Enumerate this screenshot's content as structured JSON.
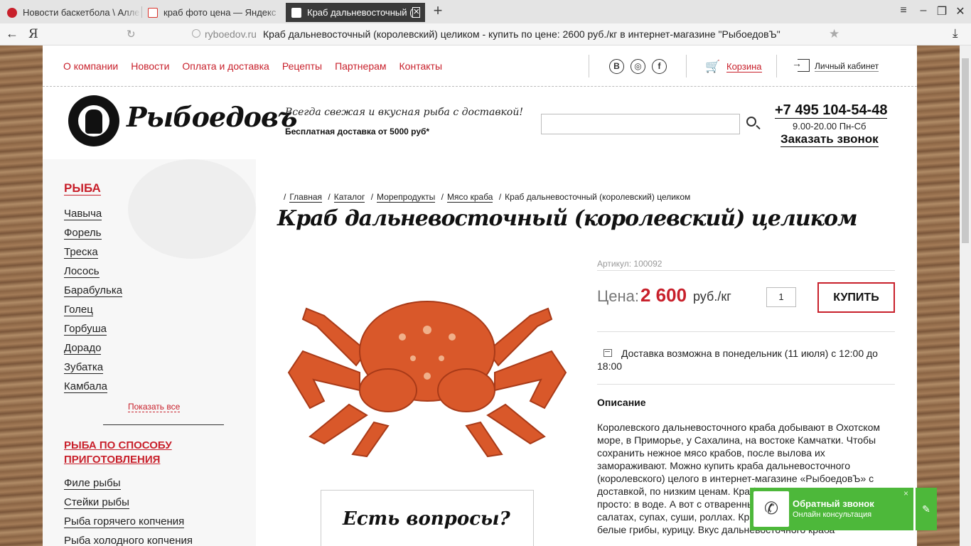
{
  "browser": {
    "tabs": [
      {
        "title": "Новости баскетбола \\ Алле",
        "icon_color": "#c8202b"
      },
      {
        "title": "краб фото цена — Яндекс",
        "icon_color": "#d9322b"
      },
      {
        "title": "Краб дальневосточный (",
        "icon_color": "#ffffff",
        "active": true
      }
    ],
    "address": {
      "domain": "ryboedov.ru",
      "page_title": "Краб дальневосточный (королевский) целиком - купить по цене: 2600 руб./кг в интернет-магазине \"РыбоедовЪ\""
    }
  },
  "nav": {
    "links": [
      "О компании",
      "Новости",
      "Оплата и доставка",
      "Рецепты",
      "Партнерам",
      "Контакты"
    ],
    "social": [
      "B",
      "◎",
      "f"
    ],
    "cart": "Корзина",
    "account": "Личный кабинет"
  },
  "header": {
    "brand": "Рыбоедовъ",
    "tagline": "Всегда свежая и вкусная рыба с доставкой!",
    "free_delivery": "Бесплатная доставка от 5000 руб*",
    "search_placeholder": "",
    "phone": "+7 495 104-54-48",
    "hours": "9.00-20.00 Пн-Сб",
    "callback": "Заказать звонок"
  },
  "sidebar": {
    "title": "РЫБА",
    "items": [
      "Чавыча",
      "Форель",
      "Треска",
      "Лосось",
      "Барабулька",
      "Голец",
      "Горбуша",
      "Дорадо",
      "Зубатка",
      "Камбала"
    ],
    "show_all": "Показать все",
    "title2": "РЫБА ПО СПОСОБУ ПРИГОТОВЛЕНИЯ",
    "items2": [
      "Филе рыбы",
      "Стейки рыбы",
      "Рыба горячего копчения",
      "Рыба холодного копчения"
    ]
  },
  "breadcrumb": {
    "links": [
      "Главная",
      "Каталог",
      "Морепродукты",
      "Мясо краба"
    ],
    "current": "Краб дальневосточный (королевский) целиком"
  },
  "product": {
    "title": "Краб дальневосточный (королевский) целиком",
    "sku": "Артикул: 100092",
    "price_label": "Цена:",
    "price": "2 600",
    "unit": "руб./кг",
    "qty": "1",
    "buy": "КУПИТЬ",
    "delivery": "Доставка возможна в понедельник (11 июля) с 12:00 до 18:00",
    "desc_title": "Описание",
    "desc": "Королевского дальневосточного краба добывают в Охотском море, в Приморье, у Сахалина, на востоке Камчатки. Чтобы сохранить нежное мясо крабов, после вылова их замораживают. Можно купить краба дальневосточного (королевского) целого в интернет-магазине «РыбоедовЪ» с доставкой, по низким ценам. Краб готовится на удивление просто: в воде. А вот с отваренным можно … Краб хорош в салатах, супах, суши, роллах. Крабом фаршируют пасту, белые грибы, курицу. Вкус дальневосточного краба"
  },
  "questions": "Есть вопросы?",
  "widget": {
    "title": "Обратный звонок",
    "subtitle": "Онлайн консультация",
    "close": "×"
  },
  "colors": {
    "accent": "#c8202b",
    "widget": "#4db83a"
  }
}
